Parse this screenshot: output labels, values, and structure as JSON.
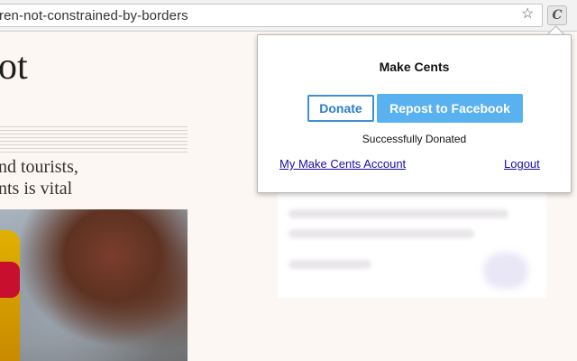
{
  "browser": {
    "url": "ren-not-constrained-by-borders",
    "bookmark_icon": "star-icon",
    "extension_icon": "make-cents-icon",
    "extension_glyph": "C"
  },
  "article": {
    "headline": "ot",
    "subline_1": "nd tourists,",
    "subline_2": "nts is vital"
  },
  "popup": {
    "title": "Make Cents",
    "donate_label": "Donate",
    "repost_label": "Repost to Facebook",
    "status_text": "Successfully Donated",
    "account_link": "My Make Cents Account",
    "logout_link": "Logout",
    "colors": {
      "donate_border": "#3d8fd6",
      "repost_bg": "#5ab1ef",
      "link": "#1a0dab"
    }
  }
}
